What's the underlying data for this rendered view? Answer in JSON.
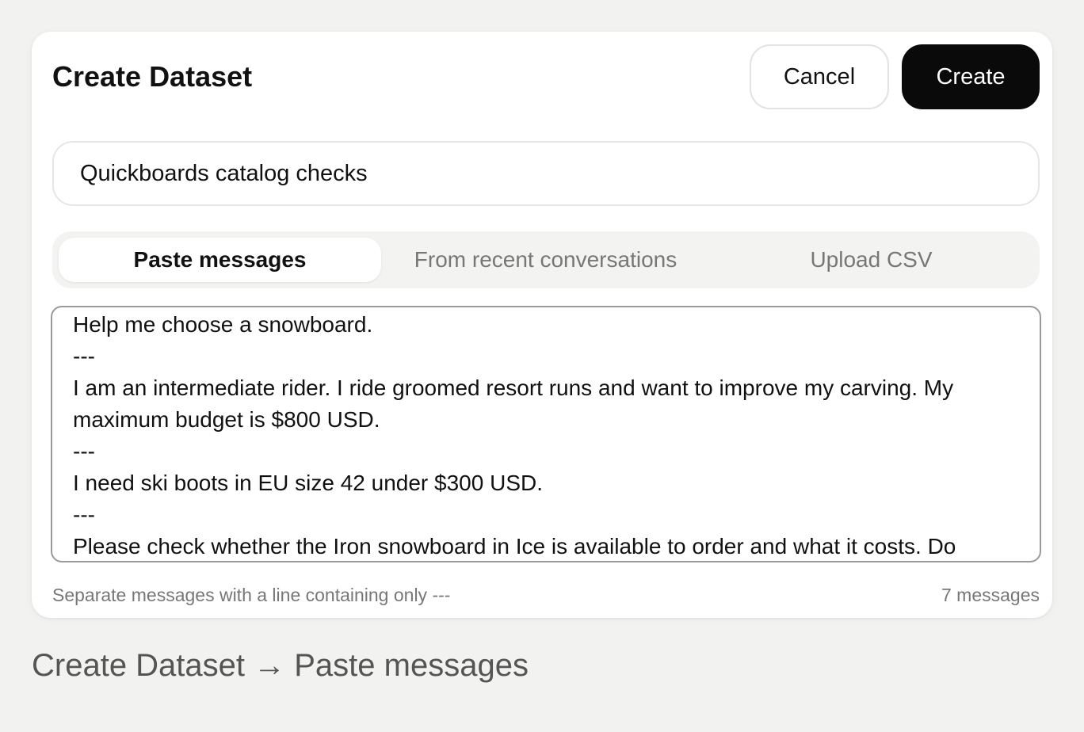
{
  "dialog": {
    "title": "Create Dataset",
    "cancel_label": "Cancel",
    "create_label": "Create",
    "name_value": "Quickboards catalog checks",
    "tabs": [
      {
        "label": "Paste messages",
        "active": true
      },
      {
        "label": "From recent conversations",
        "active": false
      },
      {
        "label": "Upload CSV",
        "active": false
      }
    ],
    "messages_lines": [
      "Help me choose a snowboard.",
      "---",
      "I am an intermediate rider. I ride groomed resort runs and want to improve my carving. My maximum budget is $800 USD.",
      "---",
      "I need ski boots in EU size 42 under $300 USD.",
      "---",
      "Please check whether the Iron snowboard in Ice is available to order and what it costs. Do"
    ],
    "hint": "Separate messages with a line containing only ---",
    "message_count": "7 messages"
  },
  "breadcrumb": "Create Dataset → Paste messages",
  "colors": {
    "background": "#f2f2f0",
    "card": "#ffffff",
    "primary_button": "#0a0a0a",
    "muted_text": "#777777"
  }
}
